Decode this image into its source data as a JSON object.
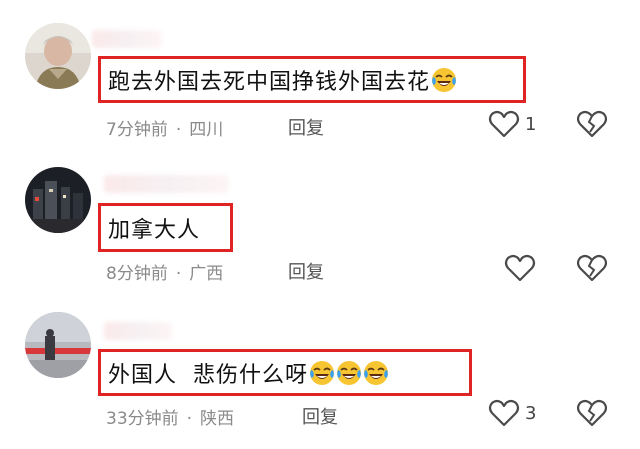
{
  "comments": [
    {
      "text": "跑去外国去死中国挣钱外国去花",
      "emoji_count": 1,
      "time": "7分钟前",
      "location": "四川",
      "reply_label": "回复",
      "likes": "1"
    },
    {
      "text": "加拿大人",
      "emoji_count": 0,
      "time": "8分钟前",
      "location": "广西",
      "reply_label": "回复",
      "likes": ""
    },
    {
      "text": "外国人  悲伤什么呀",
      "emoji_count": 3,
      "time": "33分钟前",
      "location": "陕西",
      "reply_label": "回复",
      "likes": "3"
    }
  ],
  "separator": "·",
  "colors": {
    "highlight_border": "#e02424",
    "meta_text": "#8a8a8a",
    "icon_stroke": "#4a4a4a"
  },
  "icons": [
    "laughing-crying-emoji",
    "heart-outline-icon",
    "broken-heart-icon"
  ]
}
